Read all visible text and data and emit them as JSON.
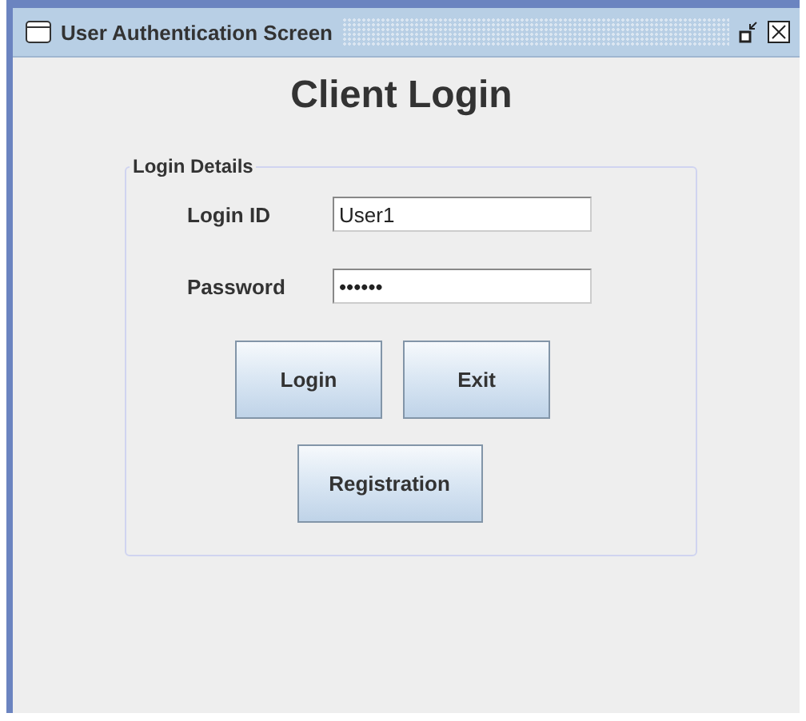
{
  "window": {
    "title": "User Authentication Screen"
  },
  "heading": "Client Login",
  "group": {
    "title": "Login Details",
    "fields": [
      {
        "label": "Login ID",
        "value": "User1"
      },
      {
        "label": "Password",
        "value": "••••••"
      }
    ],
    "buttons": [
      {
        "label": "Login"
      },
      {
        "label": "Exit"
      },
      {
        "label": "Registration"
      }
    ]
  }
}
